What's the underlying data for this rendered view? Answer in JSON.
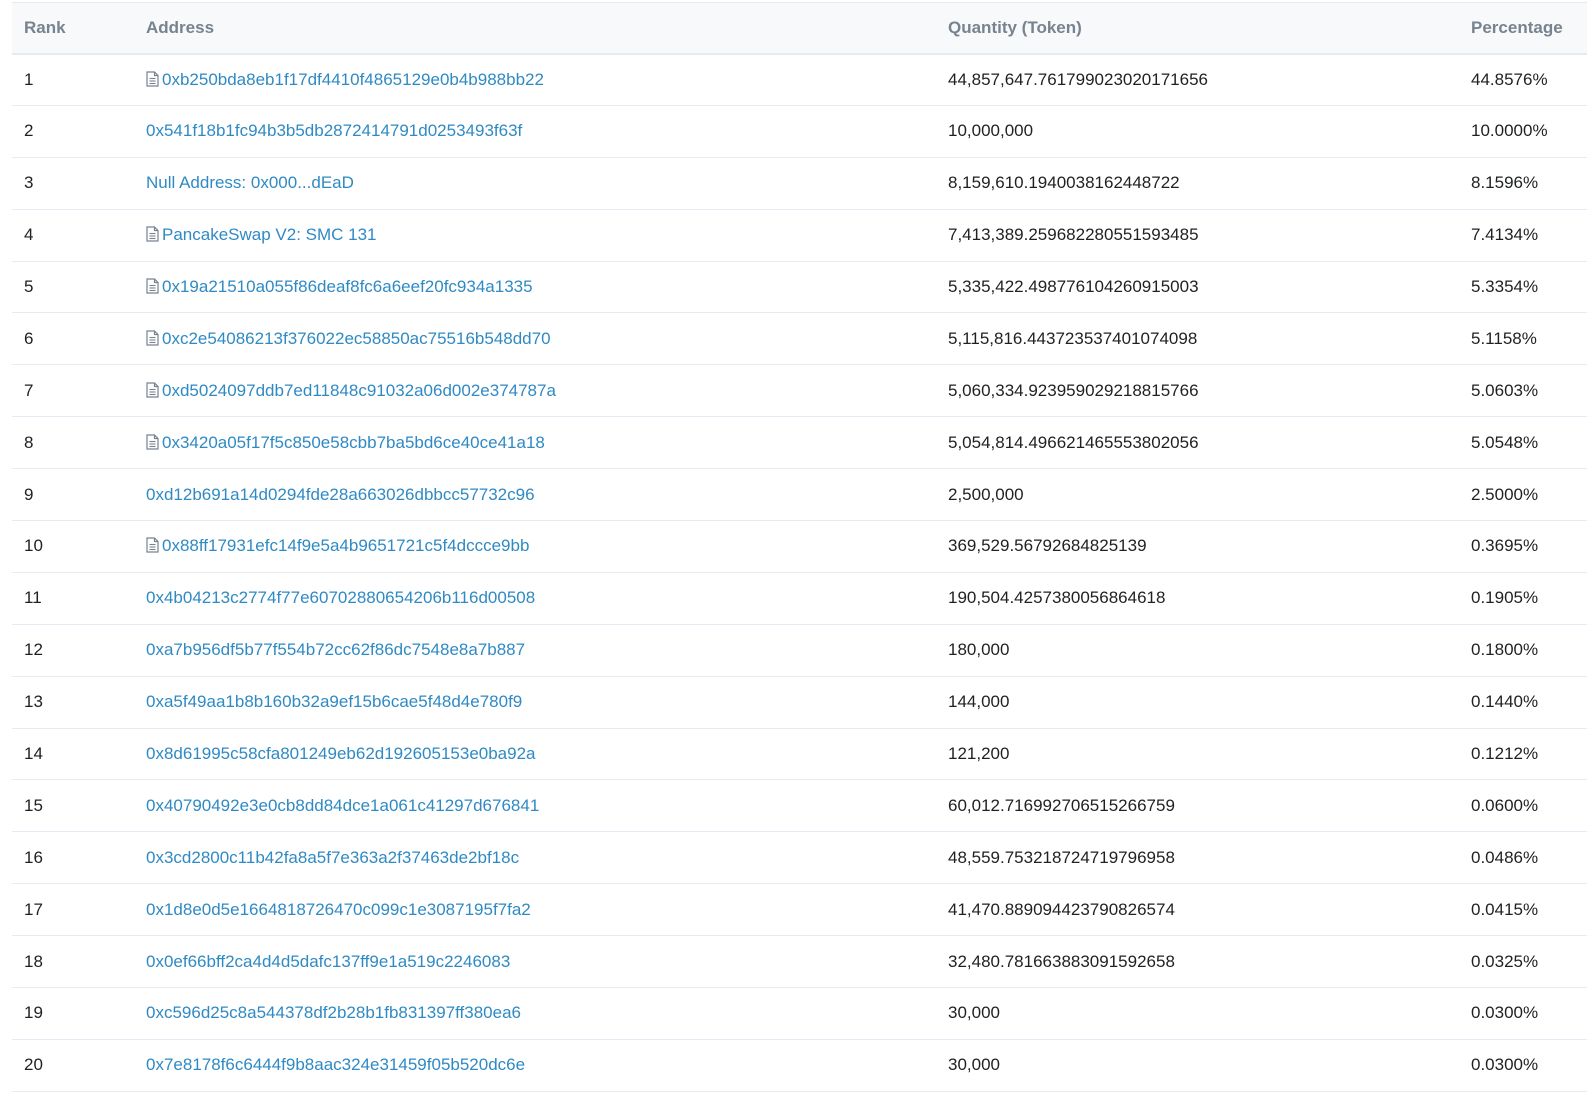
{
  "table": {
    "headers": {
      "rank": "Rank",
      "address": "Address",
      "quantity": "Quantity (Token)",
      "percentage": "Percentage"
    },
    "rows": [
      {
        "rank": "1",
        "address": "0xb250bda8eb1f17df4410f4865129e0b4b988bb22",
        "is_contract": true,
        "quantity": "44,857,647.761799023020171656",
        "percentage": "44.8576%"
      },
      {
        "rank": "2",
        "address": "0x541f18b1fc94b3b5db2872414791d0253493f63f",
        "is_contract": false,
        "quantity": "10,000,000",
        "percentage": "10.0000%"
      },
      {
        "rank": "3",
        "address": "Null Address: 0x000...dEaD",
        "is_contract": false,
        "quantity": "8,159,610.1940038162448722",
        "percentage": "8.1596%"
      },
      {
        "rank": "4",
        "address": "PancakeSwap V2: SMC 131",
        "is_contract": true,
        "quantity": "7,413,389.259682280551593485",
        "percentage": "7.4134%"
      },
      {
        "rank": "5",
        "address": "0x19a21510a055f86deaf8fc6a6eef20fc934a1335",
        "is_contract": true,
        "quantity": "5,335,422.498776104260915003",
        "percentage": "5.3354%"
      },
      {
        "rank": "6",
        "address": "0xc2e54086213f376022ec58850ac75516b548dd70",
        "is_contract": true,
        "quantity": "5,115,816.443723537401074098",
        "percentage": "5.1158%"
      },
      {
        "rank": "7",
        "address": "0xd5024097ddb7ed11848c91032a06d002e374787a",
        "is_contract": true,
        "quantity": "5,060,334.923959029218815766",
        "percentage": "5.0603%"
      },
      {
        "rank": "8",
        "address": "0x3420a05f17f5c850e58cbb7ba5bd6ce40ce41a18",
        "is_contract": true,
        "quantity": "5,054,814.496621465553802056",
        "percentage": "5.0548%"
      },
      {
        "rank": "9",
        "address": "0xd12b691a14d0294fde28a663026dbbcc57732c96",
        "is_contract": false,
        "quantity": "2,500,000",
        "percentage": "2.5000%"
      },
      {
        "rank": "10",
        "address": "0x88ff17931efc14f9e5a4b9651721c5f4dccce9bb",
        "is_contract": true,
        "quantity": "369,529.56792684825139",
        "percentage": "0.3695%"
      },
      {
        "rank": "11",
        "address": "0x4b04213c2774f77e60702880654206b116d00508",
        "is_contract": false,
        "quantity": "190,504.4257380056864618",
        "percentage": "0.1905%"
      },
      {
        "rank": "12",
        "address": "0xa7b956df5b77f554b72cc62f86dc7548e8a7b887",
        "is_contract": false,
        "quantity": "180,000",
        "percentage": "0.1800%"
      },
      {
        "rank": "13",
        "address": "0xa5f49aa1b8b160b32a9ef15b6cae5f48d4e780f9",
        "is_contract": false,
        "quantity": "144,000",
        "percentage": "0.1440%"
      },
      {
        "rank": "14",
        "address": "0x8d61995c58cfa801249eb62d192605153e0ba92a",
        "is_contract": false,
        "quantity": "121,200",
        "percentage": "0.1212%"
      },
      {
        "rank": "15",
        "address": "0x40790492e3e0cb8dd84dce1a061c41297d676841",
        "is_contract": false,
        "quantity": "60,012.716992706515266759",
        "percentage": "0.0600%"
      },
      {
        "rank": "16",
        "address": "0x3cd2800c11b42fa8a5f7e363a2f37463de2bf18c",
        "is_contract": false,
        "quantity": "48,559.753218724719796958",
        "percentage": "0.0486%"
      },
      {
        "rank": "17",
        "address": "0x1d8e0d5e1664818726470c099c1e3087195f7fa2",
        "is_contract": false,
        "quantity": "41,470.889094423790826574",
        "percentage": "0.0415%"
      },
      {
        "rank": "18",
        "address": "0x0ef66bff2ca4d4d5dafc137ff9e1a519c2246083",
        "is_contract": false,
        "quantity": "32,480.781663883091592658",
        "percentage": "0.0325%"
      },
      {
        "rank": "19",
        "address": "0xc596d25c8a544378df2b28b1fb831397ff380ea6",
        "is_contract": false,
        "quantity": "30,000",
        "percentage": "0.0300%"
      },
      {
        "rank": "20",
        "address": "0x7e8178f6c6444f9b8aac324e31459f05b520dc6e",
        "is_contract": false,
        "quantity": "30,000",
        "percentage": "0.0300%"
      }
    ]
  },
  "icons": {
    "contract": "file-document-icon"
  },
  "colors": {
    "link": "#2f8ac4",
    "header_text": "#77838f",
    "body_text": "#1e2022",
    "border": "#e7eaf3",
    "header_bg": "#f8f9fa"
  }
}
